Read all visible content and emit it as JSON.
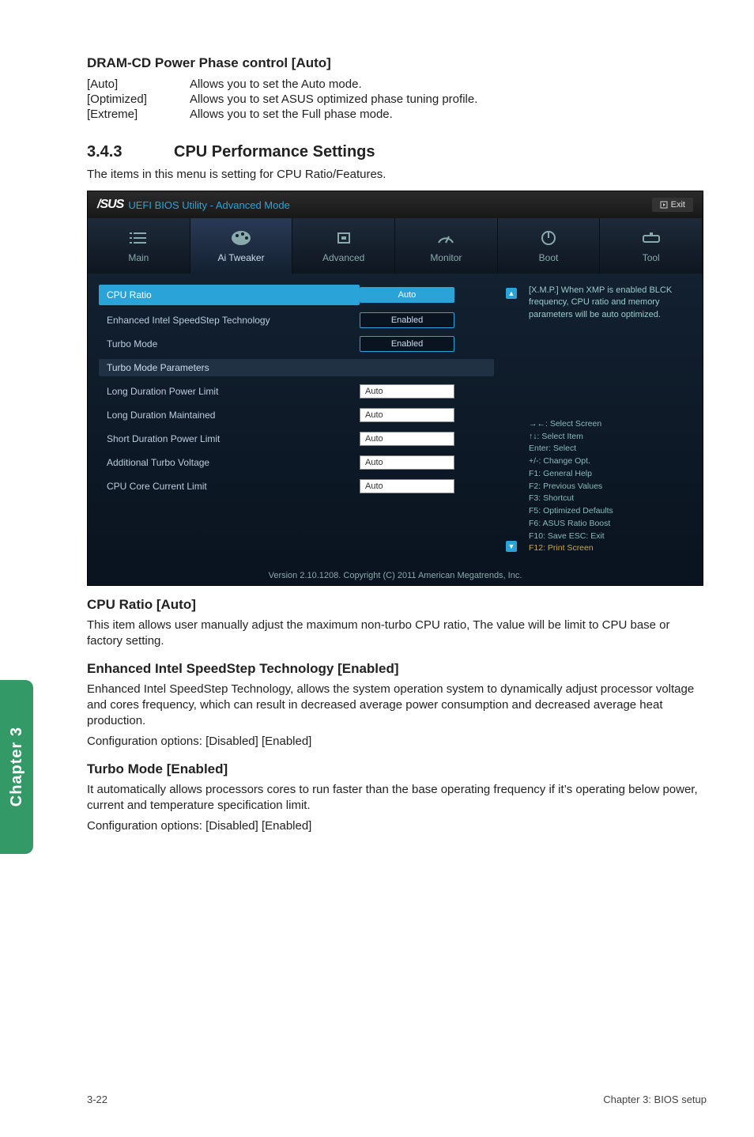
{
  "dram": {
    "heading": "DRAM-CD Power Phase control [Auto]",
    "rows": [
      {
        "k": "[Auto]",
        "v": "Allows you to set the Auto mode."
      },
      {
        "k": "[Optimized]",
        "v": "Allows you to set ASUS optimized phase tuning profile."
      },
      {
        "k": "[Extreme]",
        "v": "Allows you to set the Full phase mode."
      }
    ]
  },
  "section": {
    "num": "3.4.3",
    "title": "CPU Performance Settings",
    "lead": "The items in this menu is setting for CPU Ratio/Features."
  },
  "bios": {
    "brand": "/SUS",
    "mode": "UEFI BIOS Utility - Advanced Mode",
    "exit": "Exit",
    "tabs": [
      "Main",
      "Ai Tweaker",
      "Advanced",
      "Monitor",
      "Boot",
      "Tool"
    ],
    "active_tab": 1,
    "rows": [
      {
        "label": "CPU Ratio",
        "value": "Auto",
        "hl": true,
        "pillhl": true
      },
      {
        "label": "Enhanced Intel SpeedStep Technology",
        "value": "Enabled",
        "pill": true
      },
      {
        "label": "Turbo Mode",
        "value": "Enabled",
        "pill": true
      }
    ],
    "group": "Turbo Mode Parameters",
    "rows2": [
      {
        "label": "Long Duration Power Limit",
        "value": "Auto"
      },
      {
        "label": "Long Duration Maintained",
        "value": "Auto"
      },
      {
        "label": "Short Duration Power Limit",
        "value": "Auto"
      },
      {
        "label": "Additional Turbo Voltage",
        "value": "Auto"
      },
      {
        "label": "CPU Core Current Limit",
        "value": "Auto"
      }
    ],
    "help_top": "[X.M.P.] When XMP is enabled BLCK frequency, CPU ratio and memory parameters will be auto optimized.",
    "keys": [
      "→←: Select Screen",
      "↑↓: Select Item",
      "Enter: Select",
      "+/-: Change Opt.",
      "F1: General Help",
      "F2: Previous Values",
      "F3: Shortcut",
      "F5: Optimized Defaults",
      "F6: ASUS Ratio Boost",
      "F10: Save   ESC: Exit",
      "F12: Print Screen"
    ],
    "footer": "Version 2.10.1208. Copyright (C) 2011 American Megatrends, Inc."
  },
  "cpu_ratio": {
    "heading": "CPU Ratio [Auto]",
    "body": "This item allows user manually adjust the maximum non-turbo CPU ratio, The value will be limit to CPU base or factory setting."
  },
  "speedstep": {
    "heading": "Enhanced Intel SpeedStep Technology [Enabled]",
    "body": "Enhanced Intel SpeedStep Technology, allows the system operation system to dynamically adjust processor voltage and cores frequency, which can result in decreased average power consumption and decreased average heat production.",
    "cfg": "Configuration options: [Disabled] [Enabled]"
  },
  "turbo": {
    "heading": "Turbo Mode [Enabled]",
    "body": "It automatically allows processors cores to run faster than the base operating frequency if it’s operating below power, current and temperature specification limit.",
    "cfg": "Configuration options: [Disabled] [Enabled]"
  },
  "spine": "Chapter 3",
  "pagefoot": {
    "left": "3-22",
    "right": "Chapter 3: BIOS setup"
  }
}
